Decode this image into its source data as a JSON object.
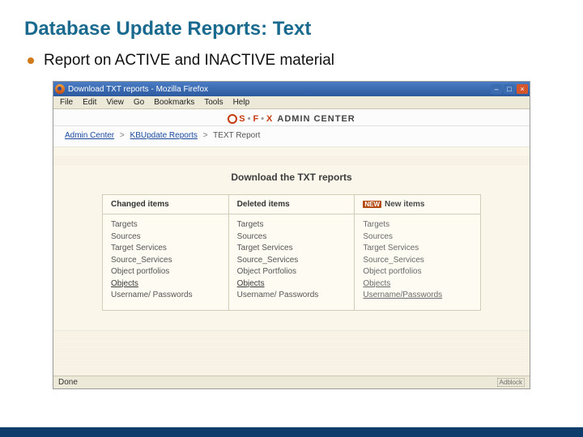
{
  "slide": {
    "title": "Database Update Reports: Text",
    "bullet": "Report on ACTIVE and INACTIVE material"
  },
  "window": {
    "title": "Download TXT reports - Mozilla Firefox",
    "menu": [
      "File",
      "Edit",
      "View",
      "Go",
      "Bookmarks",
      "Tools",
      "Help"
    ],
    "status_left": "Done",
    "status_right": "Adblock"
  },
  "admin": {
    "brand_s": "S",
    "brand_f": "F",
    "brand_x": "X",
    "label": "ADMIN CENTER"
  },
  "breadcrumb": {
    "a": "Admin Center",
    "b": "KBUpdate Reports",
    "c": "TEXT Report"
  },
  "page_title": "Download the TXT reports",
  "columns": [
    {
      "header": "Changed items",
      "highlight": false,
      "items": [
        {
          "label": "Targets",
          "ul": false
        },
        {
          "label": "Sources",
          "ul": false
        },
        {
          "label": "Target Services",
          "ul": false
        },
        {
          "label": "Source_Services",
          "ul": false
        },
        {
          "label": "Object portfolios",
          "ul": false
        },
        {
          "label": "Objects",
          "ul": true
        },
        {
          "label": "Username/ Passwords",
          "ul": false
        }
      ]
    },
    {
      "header": "Deleted items",
      "highlight": false,
      "items": [
        {
          "label": "Targets",
          "ul": false
        },
        {
          "label": "Sources",
          "ul": false
        },
        {
          "label": "Target Services",
          "ul": false
        },
        {
          "label": "Source_Services",
          "ul": false
        },
        {
          "label": "Object Portfolios",
          "ul": false
        },
        {
          "label": "Objects",
          "ul": true
        },
        {
          "label": "Username/ Passwords",
          "ul": false
        }
      ]
    },
    {
      "header": "New items",
      "highlight": true,
      "items": [
        {
          "label": "Targets",
          "ul": false
        },
        {
          "label": "Sources",
          "ul": false
        },
        {
          "label": "Target Services",
          "ul": false
        },
        {
          "label": "Source_Services",
          "ul": false
        },
        {
          "label": "Object portfolios",
          "ul": false
        },
        {
          "label": "Objects",
          "ul": true
        },
        {
          "label": "Username/Passwords",
          "ul": true
        }
      ]
    }
  ]
}
